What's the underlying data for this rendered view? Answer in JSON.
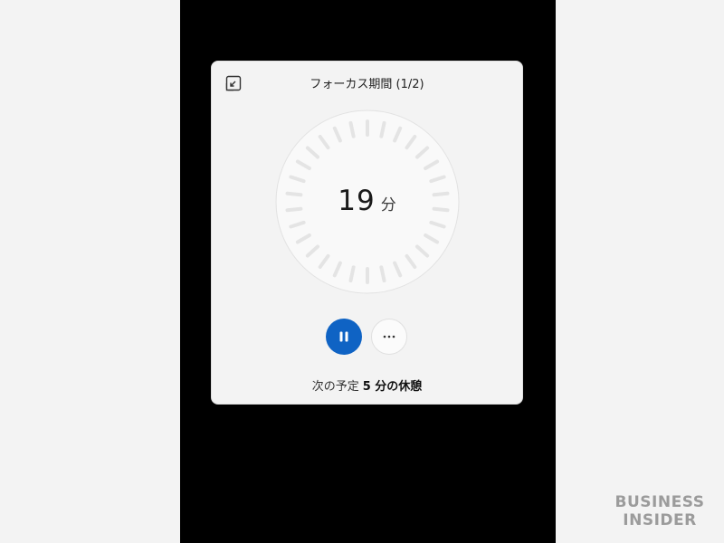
{
  "session_title": "フォーカス期間 (1/2)",
  "timer": {
    "value": "19",
    "unit": "分",
    "progress_fraction": 0.0
  },
  "controls": {
    "pause_icon": "pause-icon",
    "more_label": "···"
  },
  "next_up": {
    "prefix": "次の予定",
    "detail": "5 分の休憩"
  },
  "watermark": {
    "line1": "BUSINESS",
    "line2": "INSIDER"
  },
  "colors": {
    "accent": "#0f63c4",
    "tick": "#e4e4e4",
    "dial_face": "#f9f9f9",
    "watermark": "#9b9b9b"
  }
}
